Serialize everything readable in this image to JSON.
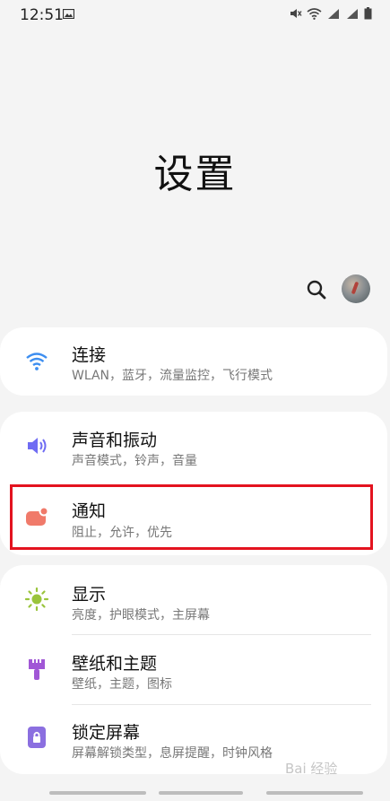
{
  "status_bar": {
    "time": "12:51"
  },
  "page": {
    "title": "设置"
  },
  "settings": {
    "connections": {
      "title": "连接",
      "subtitle": "WLAN，蓝牙，流量监控，飞行模式"
    },
    "sound": {
      "title": "声音和振动",
      "subtitle": "声音模式，铃声，音量"
    },
    "notifications": {
      "title": "通知",
      "subtitle": "阻止，允许，优先"
    },
    "display": {
      "title": "显示",
      "subtitle": "亮度，护眼模式，主屏幕"
    },
    "wallpaper": {
      "title": "壁纸和主题",
      "subtitle": "壁纸，主题，图标"
    },
    "lockscreen": {
      "title": "锁定屏幕",
      "subtitle": "屏幕解锁类型，息屏提醒，时钟风格"
    }
  },
  "watermark": "Bai 经验",
  "colors": {
    "highlight": "#e3131f",
    "wifi": "#3d8ef0",
    "sound": "#6f6cf3",
    "notify": "#f07a6a",
    "display": "#9ac43c",
    "wallpaper": "#a157d6",
    "lock": "#8b6fe0"
  },
  "icons": [
    "image-icon",
    "mute-icon",
    "wifi-icon",
    "signal-icon",
    "battery-icon",
    "search-icon",
    "avatar",
    "wifi-icon",
    "speaker-icon",
    "notification-icon",
    "sun-icon",
    "brush-icon",
    "lock-icon"
  ]
}
